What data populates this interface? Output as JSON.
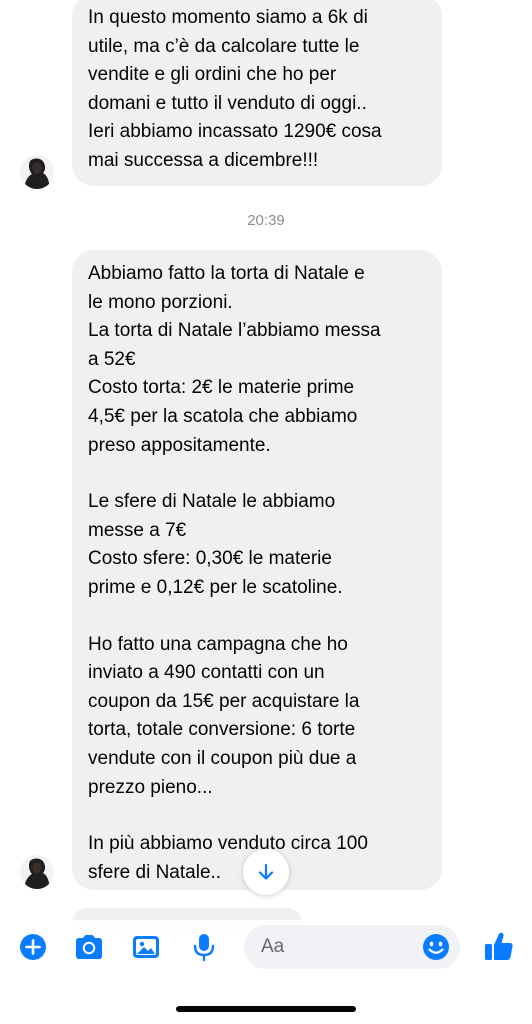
{
  "messages": [
    {
      "lines": [
        "In questo momento siamo a 6k di",
        "utile, ma c’è da calcolare tutte le",
        "vendite e gli ordini che ho per",
        "domani e tutto il venduto di oggi..",
        "Ieri abbiamo incassato 1290€ cosa",
        "mai successa a dicembre!!!"
      ]
    },
    {
      "lines": [
        "Abbiamo fatto la torta di Natale e",
        "le mono porzioni.",
        "La torta di Natale l’abbiamo messa",
        "a 52€",
        "Costo torta: 2€ le materie prime",
        "4,5€ per la scatola che abbiamo",
        "preso appositamente.",
        "",
        "Le sfere di Natale le abbiamo",
        "messe a 7€",
        "Costo sfere: 0,30€ le materie",
        "prime e 0,12€ per le scatoline.",
        "",
        "Ho fatto una campagna che ho",
        "inviato a 490 contatti con un",
        "coupon da 15€ per acquistare la",
        "torta, totale conversione: 6 torte",
        "vendute con il coupon più due a",
        "prezzo pieno...",
        "",
        "In più abbiamo venduto circa 100",
        "sfere di Natale.."
      ]
    }
  ],
  "timestamp": "20:39",
  "composer": {
    "placeholder": "Aa",
    "icons": [
      "plus-icon",
      "camera-icon",
      "image-icon",
      "microphone-icon",
      "emoji-icon",
      "thumbs-up-icon"
    ]
  },
  "colors": {
    "accent": "#0a7cff",
    "bubble": "#eff0f1",
    "timestamp": "#8a8d91"
  }
}
